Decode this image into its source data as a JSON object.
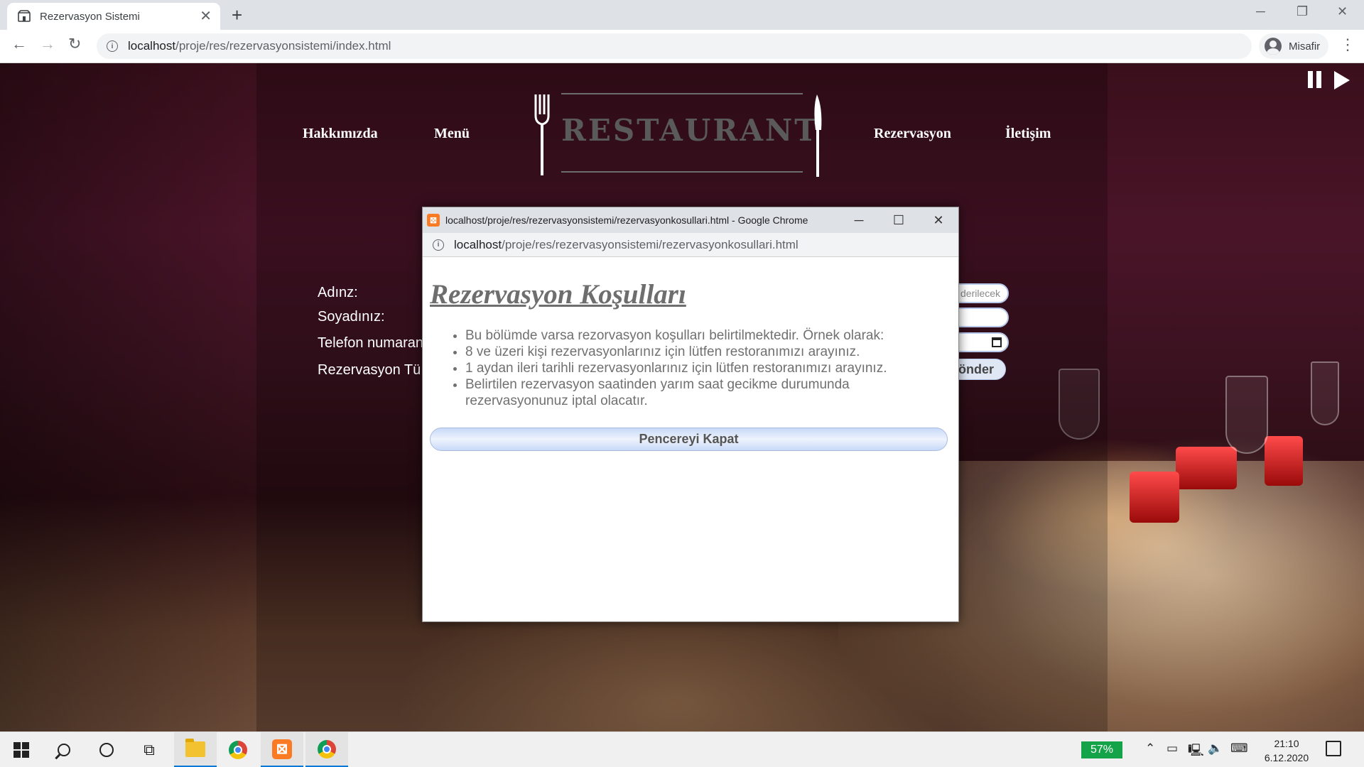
{
  "browser": {
    "tab_title": "Rezervasyon Sistemi",
    "tab_close": "✕",
    "new_tab": "+",
    "url_host": "localhost",
    "url_path": "/proje/res/rezervasyonsistemi/index.html",
    "profile_label": "Misafir",
    "window_controls": {
      "minimize": "─",
      "restore": "❐",
      "close": "✕"
    }
  },
  "site": {
    "nav": {
      "about": "Hakkımızda",
      "menu": "Menü",
      "reservation": "Rezervasyon",
      "contact": "İletişim"
    },
    "logo_text": "RESTAURANT",
    "form": {
      "name_label": "Adınz:",
      "surname_label": "Soyadınız:",
      "phone_label": "Telefon numaran",
      "type_label": "Rezervasyon Tü",
      "partial_placeholder": "derilecek",
      "submit_partial": "önder"
    }
  },
  "popup": {
    "title": "localhost/proje/res/rezervasyonsistemi/rezervasyonkosullari.html - Google Chrome",
    "url_host": "localhost",
    "url_path": "/proje/res/rezervasyonsistemi/rezervasyonkosullari.html",
    "controls": {
      "minimize": "─",
      "maximize": "☐",
      "close": "✕"
    },
    "heading": "Rezervasyon Koşulları",
    "items": [
      "Bu bölümde varsa rezorvasyon koşulları belirtilmektedir. Örnek olarak:",
      "8 ve üzeri kişi rezervasyonlarınız için lütfen restoranımızı arayınız.",
      "1 aydan ileri tarihli rezervasyonlarınız için lütfen restoranımızı arayınız.",
      "Belirtilen rezervasyon saatinden yarım saat gecikme durumunda rezervasyonunuz iptal olacatır."
    ],
    "close_button": "Pencereyi Kapat"
  },
  "taskbar": {
    "battery": "57%",
    "time": "21:10",
    "date": "6.12.2020"
  }
}
